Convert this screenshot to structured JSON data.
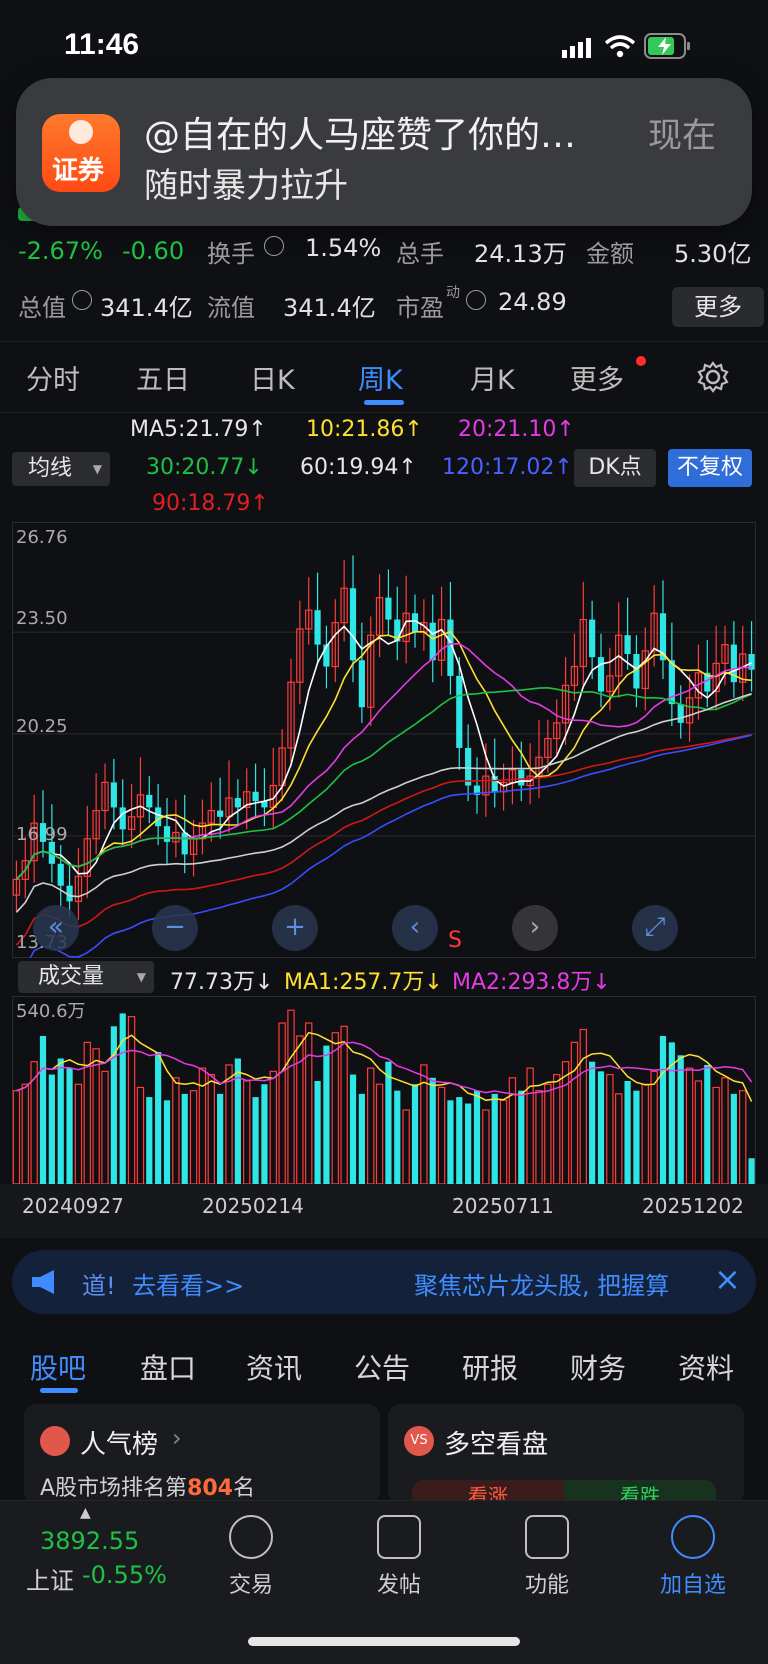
{
  "status": {
    "time": "11:46"
  },
  "notification": {
    "app_icon_text": "证券",
    "title": "@自在的人马座赞了你的…",
    "time": "现在",
    "body": "随时暴力拉升"
  },
  "quote": {
    "change_pct": "-2.67%",
    "change": "-0.60",
    "turnover_label": "换手",
    "turnover_value": "1.54%",
    "total_volume_label": "总手",
    "total_volume_value": "24.13万",
    "amount_label": "金额",
    "amount_value": "5.30亿",
    "mktcap_label": "总值",
    "mktcap_value": "341.4亿",
    "float_label": "流值",
    "float_value": "341.4亿",
    "pe_label": "市盈",
    "pe_sup": "动",
    "pe_value": "24.89",
    "more_button": "更多"
  },
  "kline_tabs": [
    {
      "label": "分时"
    },
    {
      "label": "五日"
    },
    {
      "label": "日K"
    },
    {
      "label": "周K"
    },
    {
      "label": "月K"
    },
    {
      "label": "更多"
    }
  ],
  "ma_header": {
    "indicator_select": "均线",
    "ma5": "MA5:21.79↑",
    "ma10": "10:21.86↑",
    "ma20": "20:21.10↑",
    "ma30": "30:20.77↓",
    "ma60": "60:19.94↑",
    "ma120": "120:17.02↑",
    "ma90": "90:18.79↑",
    "dk_button": "DK点",
    "adjust_button": "不复权"
  },
  "price_axis": {
    "ticks": [
      "26.76",
      "23.50",
      "20.25",
      "16.99",
      "13.73"
    ]
  },
  "volume_header": {
    "select": "成交量",
    "vol": "77.73万↓",
    "ma1": "MA1:257.7万↓",
    "ma2": "MA2:293.8万↓",
    "max_label": "540.6万"
  },
  "date_axis": [
    "20240927",
    "20250214",
    "20250711",
    "20251202"
  ],
  "chart_marker": "S",
  "banner": {
    "left_text": "道!",
    "link": "去看看>>",
    "right_text": "聚焦芯片龙头股, 把握算",
    "close": "×"
  },
  "content_tabs": [
    {
      "label": "股吧"
    },
    {
      "label": "盘口"
    },
    {
      "label": "资讯"
    },
    {
      "label": "公告"
    },
    {
      "label": "研报"
    },
    {
      "label": "财务"
    },
    {
      "label": "资料"
    }
  ],
  "cards": {
    "popularity_title": "人气榜",
    "popularity_sub_prefix": "A股市场排名第",
    "popularity_rank": "804",
    "popularity_sub_suffix": "名",
    "bullbear_title": "多空看盘",
    "bull_label": "看涨",
    "bear_label": "看跌"
  },
  "bottom_nav": {
    "index_value": "3892.55",
    "index_name": "上证",
    "index_change": "-0.55%",
    "trade": "交易",
    "post": "发帖",
    "function": "功能",
    "add_watch": "加自选"
  },
  "colors": {
    "up": "#ff3b3b",
    "down": "#1fc144",
    "accent": "#3f8cff",
    "candle_down": "#2ee6e6"
  },
  "chart_data": {
    "type": "candlestick",
    "ylim": [
      13.73,
      26.76
    ],
    "close_series": [
      15.6,
      16.2,
      17.4,
      16.8,
      16.1,
      15.4,
      14.9,
      15.7,
      16.9,
      17.8,
      18.7,
      17.9,
      17.2,
      17.6,
      18.3,
      17.9,
      17.3,
      16.8,
      17.1,
      16.4,
      16.9,
      17.4,
      17.8,
      17.6,
      18.2,
      17.9,
      18.4,
      18.1,
      17.9,
      18.6,
      19.8,
      21.9,
      23.6,
      24.2,
      23.1,
      22.4,
      23.8,
      24.9,
      22.6,
      21.1,
      23.4,
      24.6,
      23.9,
      23.2,
      24.1,
      23.5,
      23.8,
      22.6,
      23.9,
      22.1,
      19.8,
      18.6,
      18.3,
      18.9,
      18.4,
      18.7,
      19.1,
      18.6,
      18.9,
      19.5,
      20.1,
      20.6,
      21.8,
      22.4,
      23.9,
      22.7,
      21.6,
      22.1,
      23.4,
      22.8,
      21.7,
      22.9,
      24.1,
      22.6,
      21.2,
      20.6,
      21.4,
      22.2,
      21.6,
      22.5,
      23.1,
      21.9,
      22.8,
      22.3
    ],
    "volume": [
      2.9,
      3.1,
      3.8,
      4.6,
      3.4,
      3.9,
      3.6,
      3.1,
      4.4,
      4.2,
      3.5,
      4.9,
      5.3,
      5.2,
      3.0,
      2.7,
      4.1,
      2.6,
      3.3,
      2.8,
      2.9,
      3.6,
      3.4,
      2.8,
      3.7,
      3.9,
      3.2,
      2.7,
      3.1,
      3.5,
      5.0,
      5.4,
      4.6,
      5.0,
      3.2,
      4.3,
      4.7,
      4.9,
      3.4,
      2.8,
      3.6,
      3.1,
      3.8,
      2.9,
      2.3,
      3.1,
      3.7,
      3.3,
      3.0,
      2.6,
      2.7,
      2.5,
      2.9,
      2.3,
      2.8,
      2.6,
      3.3,
      2.9,
      3.6,
      2.9,
      3.1,
      3.4,
      3.8,
      4.4,
      4.8,
      3.8,
      3.5,
      3.4,
      2.8,
      3.2,
      2.9,
      3.1,
      3.5,
      4.6,
      4.4,
      4.0,
      3.6,
      3.2,
      3.7,
      3.0,
      3.3,
      2.8,
      2.9,
      0.8
    ]
  }
}
